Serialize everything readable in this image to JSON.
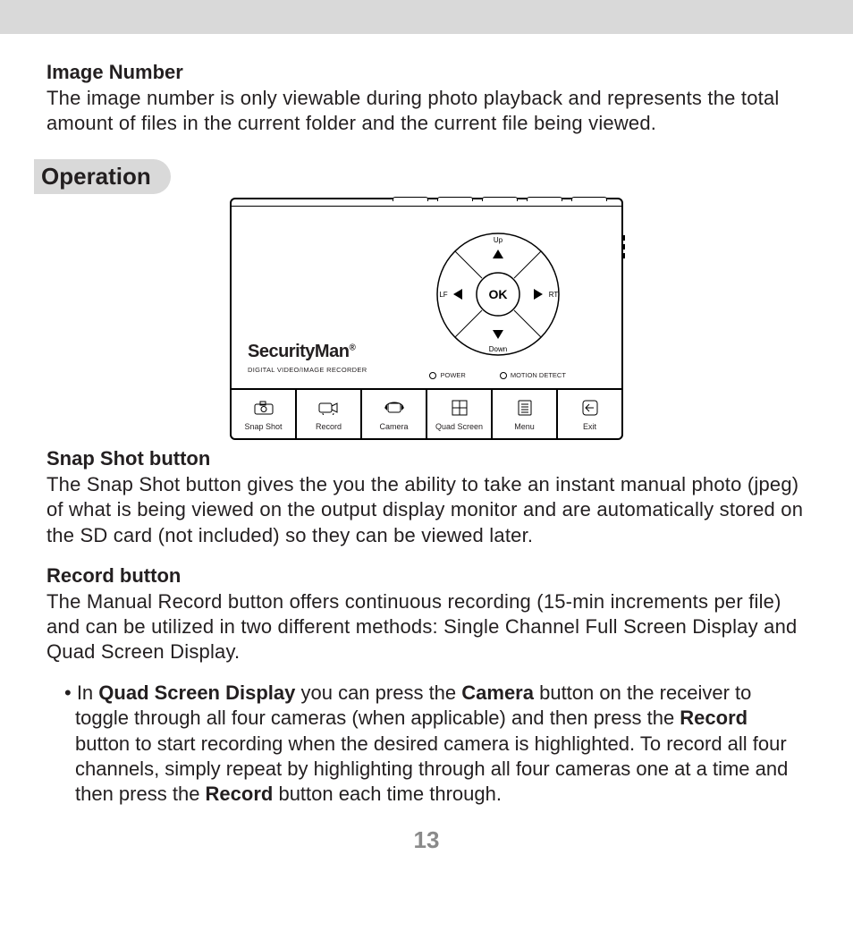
{
  "page_number": "13",
  "section_heading": "Operation",
  "image_number": {
    "title": "Image Number",
    "body": "The image number is only viewable during photo playback and represents the total amount of files in the current folder and the current file being viewed."
  },
  "snap_shot": {
    "title": "Snap Shot button",
    "body": "The Snap Shot button gives the you the ability to take an instant manual photo (jpeg) of what is being viewed on the output display monitor and are automatically stored on the SD card (not included) so they can be viewed later."
  },
  "record": {
    "title": "Record button",
    "body": "The Manual Record button offers continuous recording (15-min increments per file) and can be utilized in two different methods: Single Channel Full Screen Display and Quad Screen Display."
  },
  "bullet": {
    "prefix": "• In ",
    "b1": "Quad Screen Display",
    "t1": " you can press the ",
    "b2": "Camera",
    "t2": " button on the receiver to toggle through all four cameras (when applicable) and then press the ",
    "b3": "Record",
    "t3": " button to start recording when the desired camera is highlighted. To record all four channels, simply repeat by highlighting through all four cameras one at a time and then press the ",
    "b4": "Record",
    "t4": " button each time through."
  },
  "device": {
    "brand": "SecurityMan",
    "reg": "®",
    "subtitle": "DIGITAL  VIDEO/IMAGE RECORDER",
    "dpad": {
      "up": "Up",
      "down": "Down",
      "left": "LF",
      "right": "RT",
      "ok": "OK"
    },
    "leds": {
      "power": "POWER",
      "motion": "MOTION DETECT"
    },
    "buttons": {
      "snap": "Snap Shot",
      "record": "Record",
      "camera": "Camera",
      "quad": "Quad Screen",
      "menu": "Menu",
      "exit": "Exit"
    }
  }
}
